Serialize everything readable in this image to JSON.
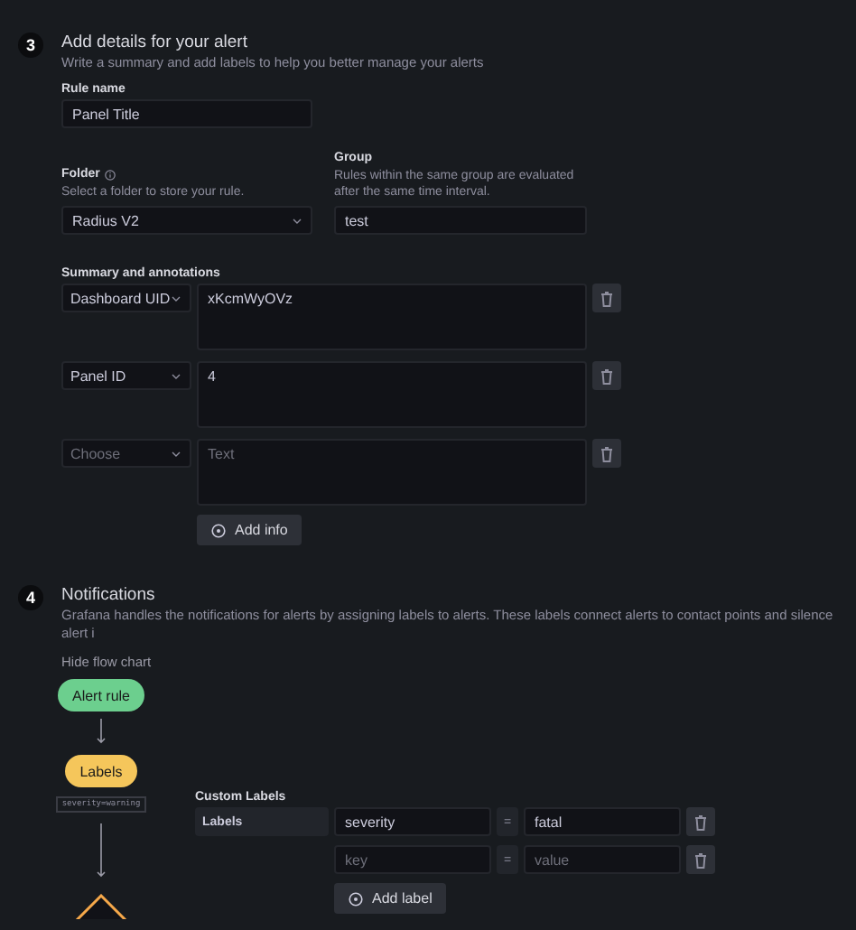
{
  "details": {
    "number": "3",
    "title": "Add details for your alert",
    "subtitle": "Write a summary and add labels to help you better manage your alerts",
    "rule_name": {
      "label": "Rule name",
      "value": "Panel Title"
    },
    "folder": {
      "label": "Folder",
      "hint": "Select a folder to store your rule.",
      "value": "Radius V2"
    },
    "group": {
      "label": "Group",
      "hint": "Rules within the same group are evaluated after the same time interval.",
      "value": "test"
    },
    "annotations": {
      "label": "Summary and annotations",
      "rows": [
        {
          "key": "Dashboard UID",
          "value": "xKcmWyOVz"
        },
        {
          "key": "Panel ID",
          "value": "4"
        },
        {
          "key_placeholder": "Choose",
          "value_placeholder": "Text"
        }
      ],
      "add_button": "Add info"
    }
  },
  "notifications": {
    "number": "4",
    "title": "Notifications",
    "description": "Grafana handles the notifications for alerts by assigning labels to alerts. These labels connect alerts to contact points and silence alert i",
    "toggle": "Hide flow chart",
    "flow": [
      {
        "kind": "pill",
        "label": "Alert rule",
        "color": "#6ccf8e"
      },
      {
        "kind": "pill",
        "label": "Labels",
        "color": "#f5c65b",
        "tag": "severity=warning"
      },
      {
        "kind": "diamond",
        "color": "#f5a84a"
      }
    ],
    "custom_labels": {
      "title": "Custom Labels",
      "row_label": "Labels",
      "rows": [
        {
          "key": "severity",
          "operator": "=",
          "value": "fatal"
        },
        {
          "key_placeholder": "key",
          "operator": "=",
          "value_placeholder": "value"
        }
      ],
      "add_button": "Add label"
    }
  }
}
